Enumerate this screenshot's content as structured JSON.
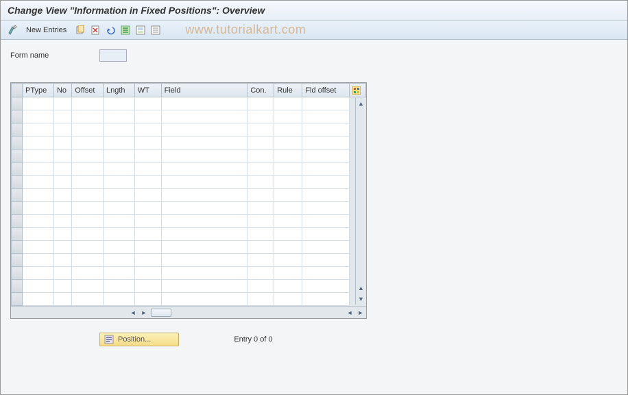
{
  "title": "Change View \"Information in Fixed Positions\": Overview",
  "toolbar": {
    "new_entries_label": "New Entries"
  },
  "watermark": "www.tutorialkart.com",
  "form": {
    "form_name_label": "Form name",
    "form_name_value": ""
  },
  "table": {
    "columns": [
      "PType",
      "No",
      "Offset",
      "Lngth",
      "WT",
      "Field",
      "Con.",
      "Rule",
      "Fld offset"
    ],
    "rows": []
  },
  "footer": {
    "position_label": "Position...",
    "entry_text": "Entry 0 of 0"
  }
}
